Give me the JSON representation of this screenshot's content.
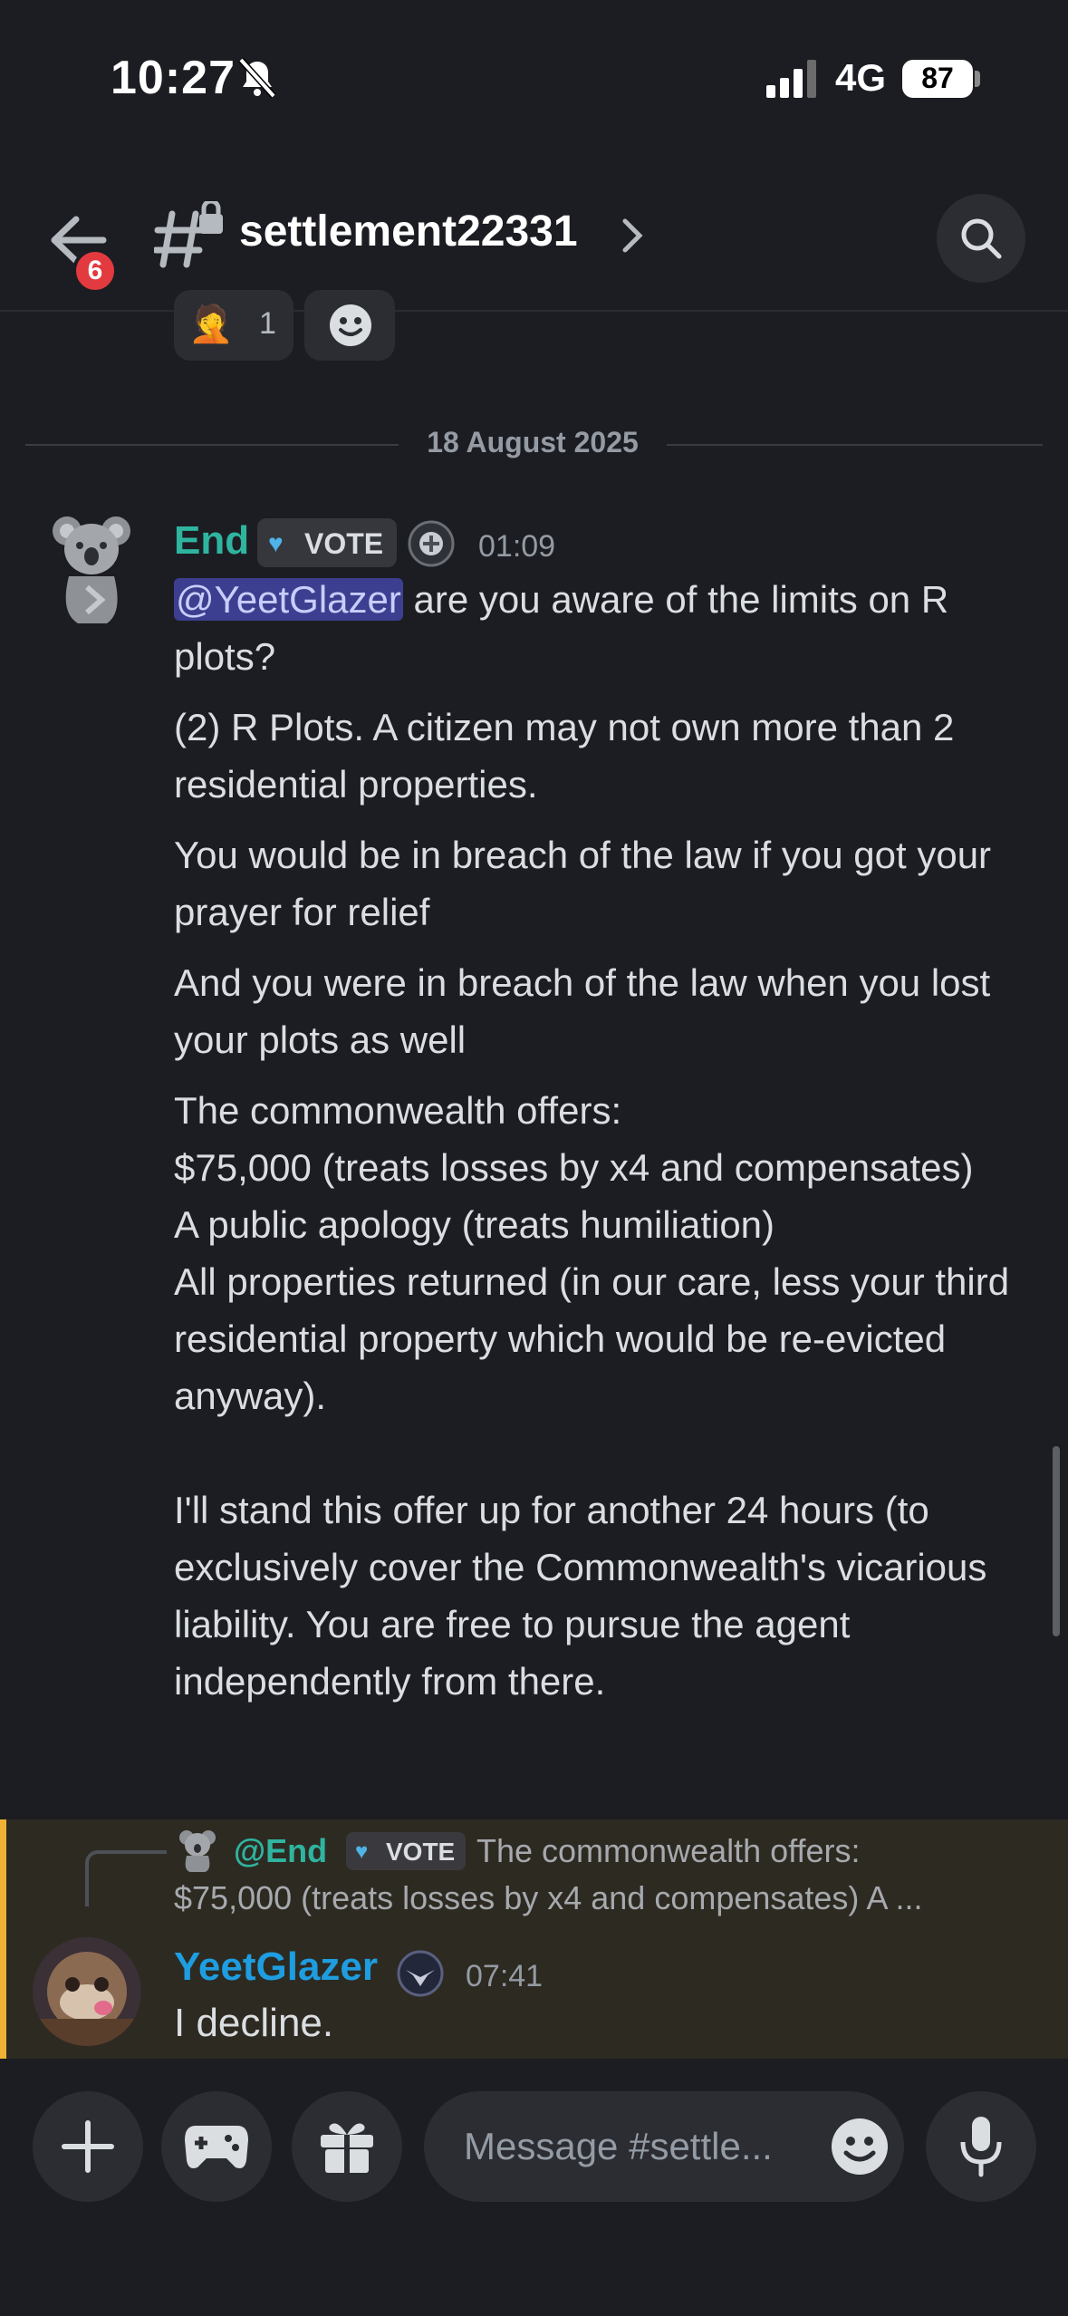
{
  "status_bar": {
    "time": "10:27",
    "network": "4G",
    "battery": "87"
  },
  "header": {
    "channel_name": "settlement22331",
    "unread_count": "6"
  },
  "reactions": [
    {
      "emoji": "🤦",
      "count": "1"
    }
  ],
  "date_divider": "18 August 2025",
  "message1": {
    "author": "End",
    "tag": "VOTE",
    "timestamp": "01:09",
    "mention": "@YeetGlazer",
    "line1_rest": " are you aware of the limits on R plots?",
    "p2": "(2) R Plots. A citizen may not own more than 2 residential properties.",
    "p3": "You would be in breach of the law if you got your prayer for relief",
    "p4": "And you were in breach of the law when you lost your plots as well",
    "p5_lines": [
      "The commonwealth offers:",
      "$75,000 (treats losses by x4 and compensates)",
      "A public apology (treats humiliation)",
      "All properties returned (in our care, less your third residential property which would be re-evicted anyway)."
    ],
    "p6": "I'll stand this offer up for another 24 hours (to exclusively cover the Commonwealth's vicarious liability. You are free to pursue the agent independently from there."
  },
  "reply": {
    "author": "@End",
    "tag": "VOTE",
    "text_line1": "The commonwealth offers:",
    "text_line2": "$75,000 (treats losses by x4 and compensates) A ..."
  },
  "message2": {
    "author": "YeetGlazer",
    "timestamp": "07:41",
    "text": "I decline."
  },
  "composer": {
    "placeholder": "Message #settle..."
  },
  "colors": {
    "accent_teal": "#2fb4a0",
    "accent_blue": "#1e9de0",
    "highlight_bar": "#f0b232",
    "mention_bg": "#3c3f8f"
  }
}
